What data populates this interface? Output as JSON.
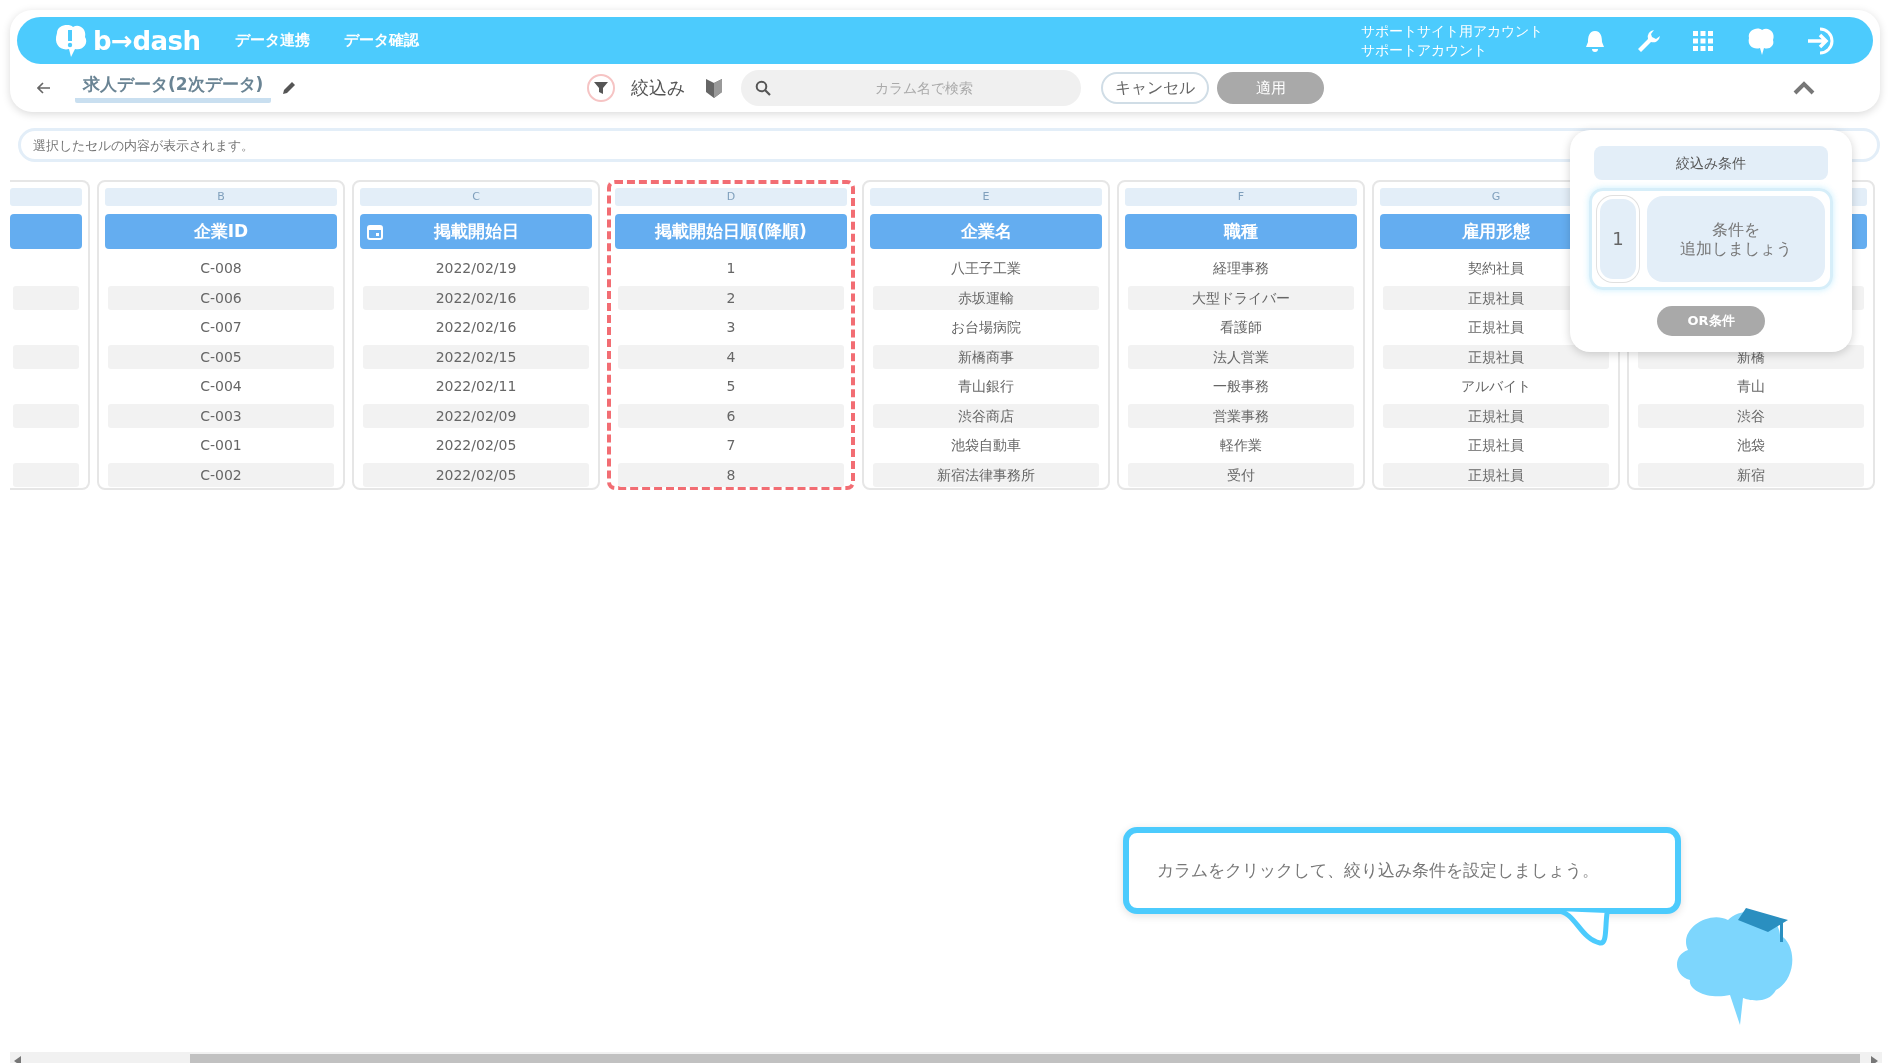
{
  "header": {
    "logo_text": "b→dash",
    "nav": [
      "データ連携",
      "データ確認"
    ],
    "account": [
      "サポートサイト用アカウント",
      "サポートアカウント"
    ]
  },
  "toolbar": {
    "title": "求人データ(2次データ)",
    "filter_label": "絞込み",
    "search": {
      "placeholder": "カラム名で検索"
    },
    "cancel": "キャンセル",
    "apply": {
      "label": "適用",
      "disabled": true
    }
  },
  "cell_preview": {
    "placeholder": "選択したセルの内容が表示されます。"
  },
  "table": {
    "columns": [
      {
        "letter": "B",
        "name": "企業ID",
        "kind": "text",
        "highlighted": false,
        "cells": [
          "C-008",
          "C-006",
          "C-007",
          "C-005",
          "C-004",
          "C-003",
          "C-001",
          "C-002"
        ]
      },
      {
        "letter": "C",
        "name": "掲載開始日",
        "kind": "date",
        "highlighted": false,
        "cells": [
          "2022/02/19",
          "2022/02/16",
          "2022/02/16",
          "2022/02/15",
          "2022/02/11",
          "2022/02/09",
          "2022/02/05",
          "2022/02/05"
        ]
      },
      {
        "letter": "D",
        "name": "掲載開始日順(降順)",
        "kind": "number",
        "highlighted": true,
        "cells": [
          "1",
          "2",
          "3",
          "4",
          "5",
          "6",
          "7",
          "8"
        ]
      },
      {
        "letter": "E",
        "name": "企業名",
        "kind": "text",
        "highlighted": false,
        "cells": [
          "八王子工業",
          "赤坂運輸",
          "お台場病院",
          "新橋商事",
          "青山銀行",
          "渋谷商店",
          "池袋自動車",
          "新宿法律事務所"
        ]
      },
      {
        "letter": "F",
        "name": "職種",
        "kind": "text",
        "highlighted": false,
        "cells": [
          "経理事務",
          "大型ドライバー",
          "看護師",
          "法人営業",
          "一般事務",
          "営業事務",
          "軽作業",
          "受付"
        ]
      },
      {
        "letter": "G",
        "name": "雇用形態",
        "kind": "text",
        "highlighted": false,
        "cells": [
          "契約社員",
          "正規社員",
          "正規社員",
          "正規社員",
          "アルバイト",
          "正規社員",
          "正規社員",
          "正規社員"
        ]
      }
    ],
    "covered_column": {
      "cells": [
        "新橋",
        "青山",
        "渋谷",
        "池袋",
        "新宿"
      ]
    }
  },
  "filter_panel": {
    "title": "絞込み条件",
    "group_number": "1",
    "hint": [
      "条件を",
      "追加しましょう"
    ],
    "or_button": {
      "label": "OR条件",
      "disabled": true
    }
  },
  "tip": {
    "text": "カラムをクリックして、絞り込み条件を設定しましょう。"
  }
}
